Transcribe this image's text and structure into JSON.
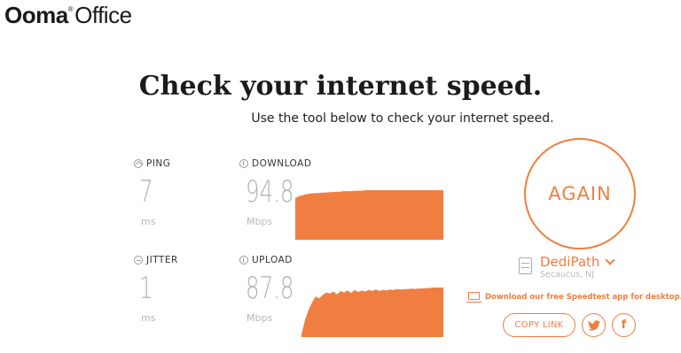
{
  "brand": {
    "part1": "Ooma",
    "trademark": "®",
    "part2": "Office"
  },
  "hero": {
    "title": "Check your internet speed.",
    "subtitle": "Use the tool below to check your internet speed."
  },
  "metrics": {
    "ping": {
      "label": "PING",
      "value": "7",
      "unit": "ms",
      "icon": "ping-icon"
    },
    "jitter": {
      "label": "JITTER",
      "value": "1",
      "unit": "ms",
      "icon": "jitter-icon"
    },
    "download": {
      "label": "DOWNLOAD",
      "value": "94.8",
      "unit": "Mbps",
      "icon": "download-icon",
      "graph": [
        0.84,
        0.88,
        0.9,
        0.92,
        0.93,
        0.94,
        0.94,
        0.95,
        0.95,
        0.96,
        0.96,
        0.97,
        0.97,
        0.98,
        0.98,
        0.98,
        0.99,
        0.99,
        0.99,
        1.0,
        1.0,
        1.0,
        1.0,
        1.0,
        1.0,
        1.0,
        1.0,
        1.0,
        1.0,
        1.0,
        1.0,
        1.0,
        1.0,
        1.0,
        1.0,
        1.0,
        1.0,
        1.0,
        1.0,
        1.0,
        1.0
      ]
    },
    "upload": {
      "label": "UPLOAD",
      "value": "87.8",
      "unit": "Mbps",
      "icon": "upload-icon",
      "graph": [
        0.05,
        0.35,
        0.55,
        0.7,
        0.82,
        0.78,
        0.85,
        0.9,
        0.88,
        0.92,
        0.86,
        0.93,
        0.9,
        0.94,
        0.89,
        0.95,
        0.91,
        0.94,
        0.92,
        0.95,
        0.93,
        0.96,
        0.93,
        0.95,
        0.94,
        0.96,
        0.95,
        0.97,
        0.96,
        0.97,
        0.97,
        0.98,
        0.97,
        0.98,
        0.98,
        0.99,
        0.99,
        1.0,
        1.0,
        1.0,
        1.0
      ]
    }
  },
  "again_button": "AGAIN",
  "server": {
    "name": "DediPath",
    "location": "Secaucus, NJ",
    "icon": "server-icon"
  },
  "download_app_link": "Download our free Speedtest app for desktop.",
  "share": {
    "copy_link": "COPY LINK",
    "twitter_icon": "twitter-icon",
    "facebook_icon": "facebook-icon",
    "facebook_glyph": "f"
  },
  "colors": {
    "accent": "#f07e40",
    "graph_fill": "#f07e40",
    "muted_text": "#b3b3b3"
  }
}
